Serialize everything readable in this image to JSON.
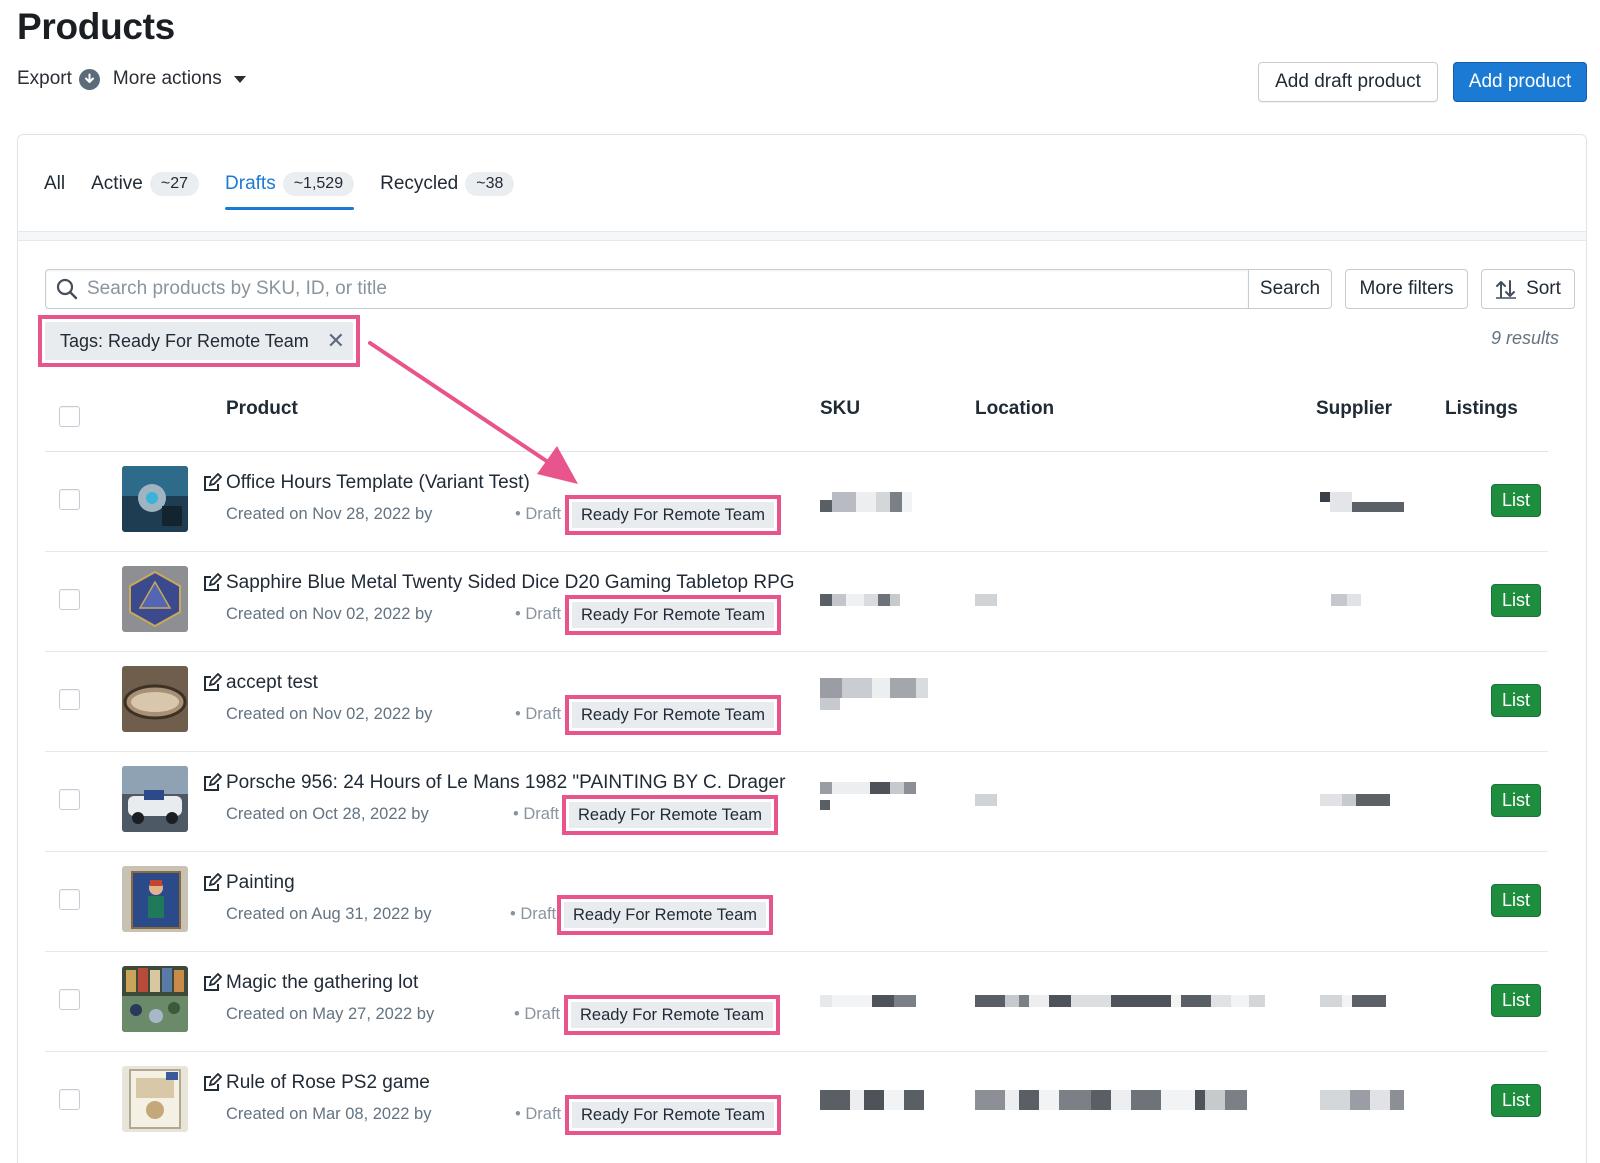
{
  "header": {
    "title": "Products",
    "export_label": "Export",
    "more_actions_label": "More actions",
    "add_draft_label": "Add draft product",
    "add_product_label": "Add product"
  },
  "tabs": [
    {
      "label": "All",
      "count": ""
    },
    {
      "label": "Active",
      "count": "~27"
    },
    {
      "label": "Drafts",
      "count": "~1,529"
    },
    {
      "label": "Recycled",
      "count": "~38"
    }
  ],
  "search": {
    "placeholder": "Search products by SKU, ID, or title",
    "value": "",
    "search_label": "Search",
    "filters_label": "More filters",
    "sort_label": "Sort"
  },
  "active_filter": {
    "label": "Tags: Ready For Remote Team"
  },
  "results_label": "9 results",
  "table": {
    "columns": [
      "Product",
      "SKU",
      "Location",
      "Supplier",
      "Listings"
    ],
    "rows": [
      {
        "title": "Office Hours Template (Variant Test)",
        "meta": "Created on Nov 28, 2022 by",
        "status": "• Draft",
        "tag": "Ready For Remote Team",
        "action": "List"
      },
      {
        "title": "Sapphire Blue Metal Twenty Sided Dice D20 Gaming Tabletop RPG",
        "meta": "Created on Nov 02, 2022 by",
        "status": "• Draft",
        "tag": "Ready For Remote Team",
        "action": "List"
      },
      {
        "title": "accept test",
        "meta": "Created on Nov 02, 2022 by",
        "status": "• Draft",
        "tag": "Ready For Remote Team",
        "action": "List"
      },
      {
        "title": "Porsche 956: 24 Hours of Le Mans 1982 \"PAINTING BY C. Drager",
        "meta": "Created on Oct 28, 2022 by",
        "status": "• Draft",
        "tag": "Ready For Remote Team",
        "action": "List"
      },
      {
        "title": "Painting",
        "meta": "Created on Aug 31, 2022 by",
        "status": "• Draft",
        "tag": "Ready For Remote Team",
        "action": "List"
      },
      {
        "title": "Magic the gathering lot",
        "meta": "Created on May 27, 2022 by",
        "status": "• Draft",
        "tag": "Ready For Remote Team",
        "action": "List"
      },
      {
        "title": "Rule of Rose PS2 game",
        "meta": "Created on Mar 08, 2022 by",
        "status": "• Draft",
        "tag": "Ready For Remote Team",
        "action": "List"
      }
    ]
  },
  "colors": {
    "primary": "#1a7ad4",
    "success": "#1e8e3e",
    "highlight": "#e8558c"
  },
  "icons": [
    "download-circle-icon",
    "caret-down-icon",
    "search-icon",
    "sort-icon",
    "close-icon",
    "edit-icon"
  ]
}
